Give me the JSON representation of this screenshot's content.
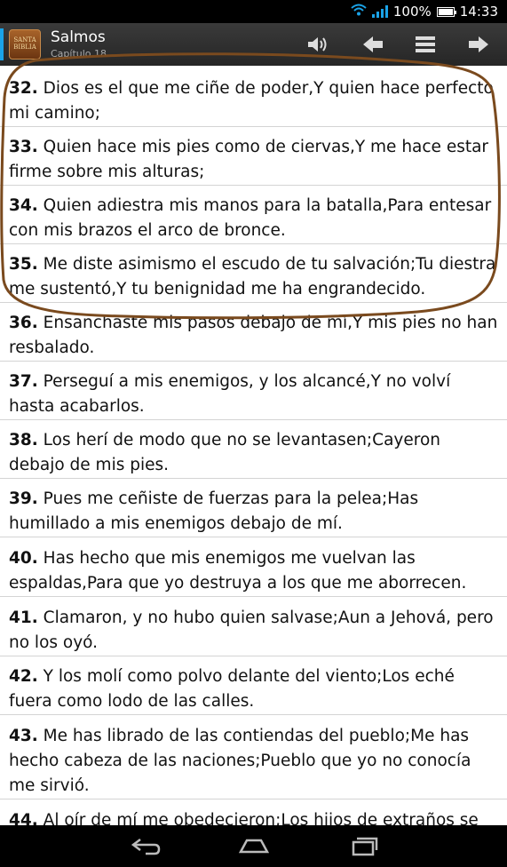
{
  "status_bar": {
    "battery_text": "100%",
    "battery_level": 1.0,
    "time": "14:33",
    "icons": [
      "wifi-icon",
      "signal-icon",
      "battery-icon"
    ]
  },
  "app_bar": {
    "app_icon_text": "SANTA BIBLIA",
    "title": "Salmos",
    "subtitle": "Capítulo 18",
    "actions": [
      "speaker-icon",
      "arrow-left-icon",
      "menu-icon",
      "arrow-right-icon"
    ]
  },
  "verses": [
    {
      "number": "32.",
      "text": " Dios es el que me ciñe de poder,Y quien hace perfecto mi camino;"
    },
    {
      "number": "33.",
      "text": " Quien hace mis pies como de ciervas,Y me hace estar firme sobre mis alturas;"
    },
    {
      "number": "34.",
      "text": " Quien adiestra mis manos para la batalla,Para entesar con mis brazos el arco de bronce."
    },
    {
      "number": "35.",
      "text": " Me diste asimismo el escudo de tu salvación;Tu diestra me sustentó,Y tu benignidad me ha engrandecido."
    },
    {
      "number": "36.",
      "text": " Ensanchaste mis pasos debajo de mí,Y mis pies no han resbalado."
    },
    {
      "number": "37.",
      "text": " Perseguí a mis enemigos, y los alcancé,Y no volví hasta acabarlos."
    },
    {
      "number": "38.",
      "text": " Los herí de modo que no se levantasen;Cayeron debajo de mis pies."
    },
    {
      "number": "39.",
      "text": " Pues me ceñiste de fuerzas para la pelea;Has humillado a mis enemigos debajo de mí."
    },
    {
      "number": "40.",
      "text": " Has hecho que mis enemigos me vuelvan las espaldas,Para que yo destruya a los que me aborrecen."
    },
    {
      "number": "41.",
      "text": " Clamaron, y no hubo quien salvase;Aun a Jehová, pero no los oyó."
    },
    {
      "number": "42.",
      "text": " Y los molí como polvo delante del viento;Los eché fuera como lodo de las calles."
    },
    {
      "number": "43.",
      "text": " Me has librado de las contiendas del pueblo;Me has hecho cabeza de las naciones;Pueblo que yo no conocía me sirvió."
    },
    {
      "number": "44.",
      "text": " Al oír de mí me obedecieron;Los hijos de extraños se sometieron a mí;"
    }
  ],
  "annotation": {
    "color": "#7a4a1e",
    "covers_verses": [
      "32.",
      "33.",
      "34.",
      "35."
    ]
  },
  "nav_bar": {
    "buttons": [
      "back-icon",
      "home-icon",
      "recent-apps-icon"
    ]
  }
}
